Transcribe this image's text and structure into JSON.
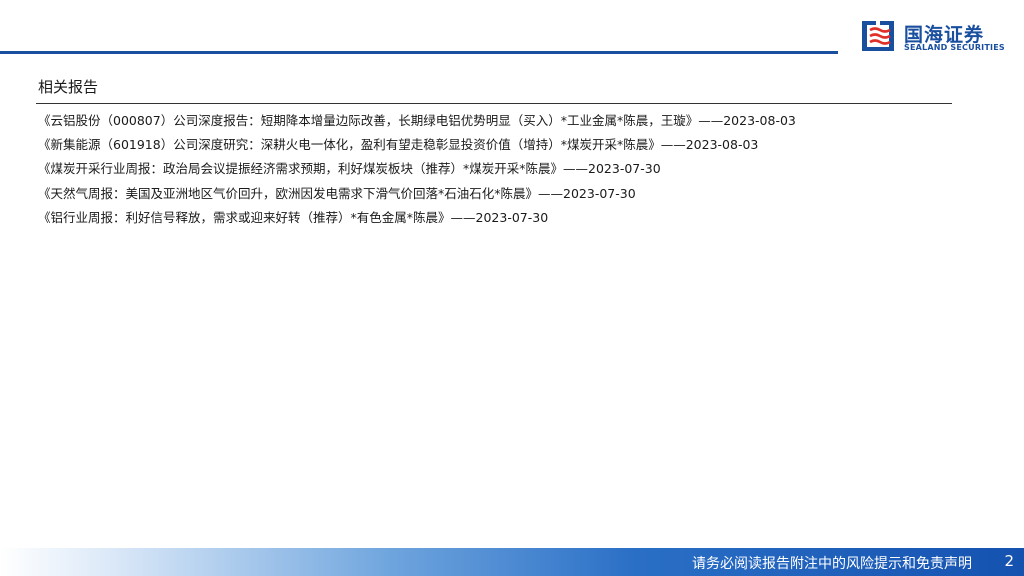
{
  "header": {
    "logo_cn": "国海证券",
    "logo_en": "SEALAND SECURITIES",
    "brand_color": "#1a4fa0",
    "logo_icon": "sealand-logo-icon"
  },
  "section": {
    "title": "相关报告"
  },
  "reports": [
    "《云铝股份（000807）公司深度报告：短期降本增量边际改善，长期绿电铝优势明显（买入）*工业金属*陈晨，王璇》——2023-08-03",
    "《新集能源（601918）公司深度研究：深耕火电一体化，盈利有望走稳彰显投资价值（增持）*煤炭开采*陈晨》——2023-08-03",
    "《煤炭开采行业周报：政治局会议提振经济需求预期，利好煤炭板块（推荐）*煤炭开采*陈晨》——2023-07-30",
    "《天然气周报：美国及亚洲地区气价回升，欧洲因发电需求下滑气价回落*石油石化*陈晨》——2023-07-30",
    "《铝行业周报：利好信号释放，需求或迎来好转（推荐）*有色金属*陈晨》——2023-07-30"
  ],
  "footer": {
    "disclaimer": "请务必阅读报告附注中的风险提示和免责声明",
    "page_number": "2"
  }
}
